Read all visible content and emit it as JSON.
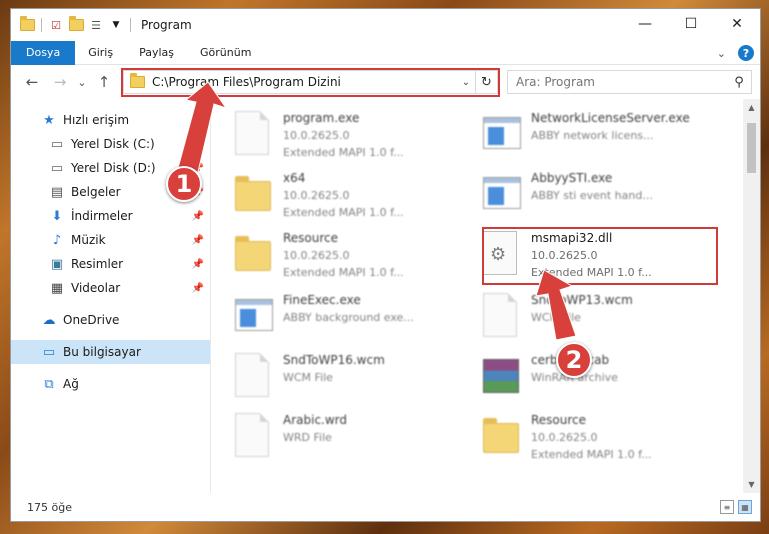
{
  "window": {
    "title": "Program",
    "controls": {
      "minimize": "—",
      "maximize": "☐",
      "close": "✕"
    }
  },
  "ribbon": {
    "tabs": [
      "Dosya",
      "Giriş",
      "Paylaş",
      "Görünüm"
    ],
    "expand_icon": "chevron-down-icon",
    "help": "?"
  },
  "nav": {
    "back": "←",
    "forward": "→",
    "recent": "⌄",
    "up": "↑",
    "address": "C:\\Program Files\\Program Dizini",
    "search_placeholder": "Ara: Program"
  },
  "sidebar": {
    "items": [
      {
        "label": "Hızlı erişim",
        "icon": "star-icon"
      },
      {
        "label": "Yerel Disk (C:)",
        "icon": "drive-icon"
      },
      {
        "label": "Yerel Disk (D:)",
        "icon": "drive-icon"
      },
      {
        "label": "Belgeler",
        "icon": "documents-icon"
      },
      {
        "label": "İndirmeler",
        "icon": "download-icon"
      },
      {
        "label": "Müzik",
        "icon": "music-icon"
      },
      {
        "label": "Resimler",
        "icon": "pictures-icon"
      },
      {
        "label": "Videolar",
        "icon": "video-icon"
      },
      {
        "label": "OneDrive",
        "icon": "cloud-icon"
      },
      {
        "label": "Bu bilgisayar",
        "icon": "computer-icon"
      },
      {
        "label": "Ağ",
        "icon": "network-icon"
      }
    ]
  },
  "files": [
    {
      "name": "program.exe",
      "line2": "10.0.2625.0",
      "line3": "Extended MAPI 1.0 f...",
      "icon": "exe-icon"
    },
    {
      "name": "NetworkLicenseServer.exe",
      "line2": "ABBY network licens...",
      "line3": "",
      "icon": "exe-icon"
    },
    {
      "name": "x64",
      "line2": "10.0.2625.0",
      "line3": "Extended MAPI 1.0 f...",
      "icon": "folder-icon"
    },
    {
      "name": "AbbyySTI.exe",
      "line2": "ABBY sti event hand...",
      "line3": "",
      "icon": "exe-icon"
    },
    {
      "name": "Resource",
      "line2": "10.0.2625.0",
      "line3": "Extended MAPI 1.0 f...",
      "icon": "folder-icon"
    },
    {
      "name": "msmapi32.dll",
      "line2": "10.0.2625.0",
      "line3": "Extended MAPI 1.0 f...",
      "icon": "dll-icon"
    },
    {
      "name": "FineExec.exe",
      "line2": "ABBY background exe...",
      "line3": "",
      "icon": "exe-icon"
    },
    {
      "name": "SndToWP13.wcm",
      "line2": "WCM File",
      "line3": "",
      "icon": "file-icon"
    },
    {
      "name": "SndToWP16.wcm",
      "line2": "WCM File",
      "line3": "",
      "icon": "file-icon"
    },
    {
      "name": "cerberus.cab",
      "line2": "WinRAR archive",
      "line3": "",
      "icon": "archive-icon"
    },
    {
      "name": "Arabic.wrd",
      "line2": "WRD File",
      "line3": "",
      "icon": "file-icon"
    },
    {
      "name": "Resource",
      "line2": "10.0.2625.0",
      "line3": "Extended MAPI 1.0 f...",
      "icon": "folder-icon"
    }
  ],
  "status": {
    "count": "175 öğe"
  },
  "annotations": {
    "marker1": "1",
    "marker2": "2",
    "accent": "#d23a3a"
  }
}
